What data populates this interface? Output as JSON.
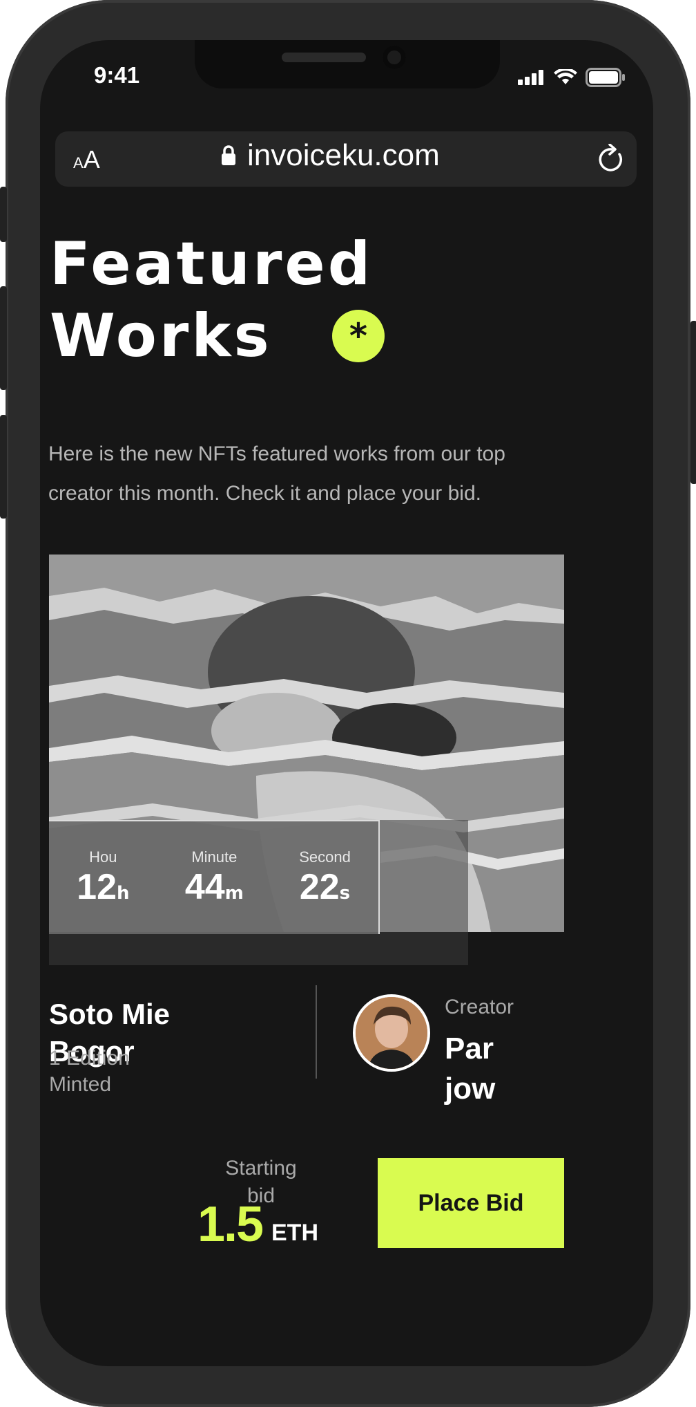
{
  "status_bar": {
    "time": "9:41",
    "icons": [
      "signal-icon",
      "wifi-icon",
      "battery-icon"
    ]
  },
  "browser": {
    "text_size_label_small": "A",
    "text_size_label_large": "A",
    "url": "invoiceku.com",
    "icons": [
      "lock-icon",
      "reload-icon"
    ]
  },
  "hero": {
    "title_line1": "Featured",
    "title_line2": "Works",
    "badge_symbol": "*",
    "description": "Here is the new NFTs featured works from our top creator this month. Check it and place your bid."
  },
  "countdown": {
    "hours_label": "Hou",
    "hours_value": "12",
    "hours_unit": "h",
    "minutes_label": "Minute",
    "minutes_value": "44",
    "minutes_unit": "m",
    "seconds_label": "Second",
    "seconds_value": "22",
    "seconds_unit": "s"
  },
  "nft": {
    "name": "Soto Mie Bogor",
    "edition": "1 Edition Minted"
  },
  "creator": {
    "label": "Creator",
    "name": "Par jow"
  },
  "bid": {
    "starting_label": "Starting bid",
    "value": "1.5",
    "unit": "ETH",
    "button_label": "Place Bid"
  },
  "colors": {
    "accent": "#d9fb50",
    "background": "#161616",
    "frame": "#2b2b2b"
  }
}
